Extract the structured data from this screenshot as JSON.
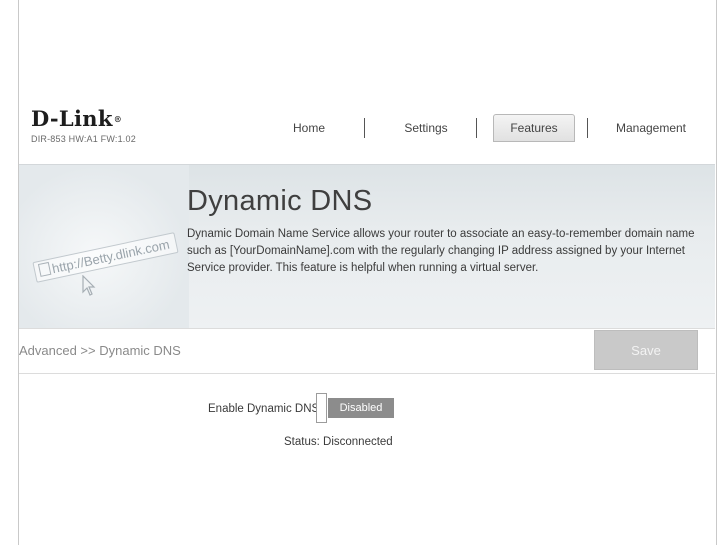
{
  "brand": {
    "logo": "D-Link",
    "logo_mark": "®",
    "model": "DIR-853 HW:A1 FW:1.02"
  },
  "nav": {
    "items": [
      {
        "label": "Home"
      },
      {
        "label": "Settings"
      },
      {
        "label": "Features",
        "active": true
      },
      {
        "label": "Management"
      }
    ]
  },
  "banner": {
    "title": "Dynamic DNS",
    "description": "Dynamic Domain Name Service allows your router to associate an easy-to-remember domain name such as [YourDomainName].com with the regularly changing IP address assigned by your Internet Service provider. This feature is helpful when running a virtual server.",
    "illustration_text": "http://Betty.dlink.com"
  },
  "breadcrumb": "Advanced >> Dynamic DNS",
  "toolbar": {
    "save_label": "Save"
  },
  "form": {
    "enable_label": "Enable Dynamic DNS:",
    "enable_value": "Disabled",
    "status_label": "Status:",
    "status_value": "Disconnected"
  },
  "colors": {
    "save_disabled": "#c9c9c9",
    "toggle_track": "#8c8c8c",
    "banner_bg": "#e8ecee"
  },
  "icons": [
    "cursor-pointer-icon",
    "url-box-icon"
  ]
}
